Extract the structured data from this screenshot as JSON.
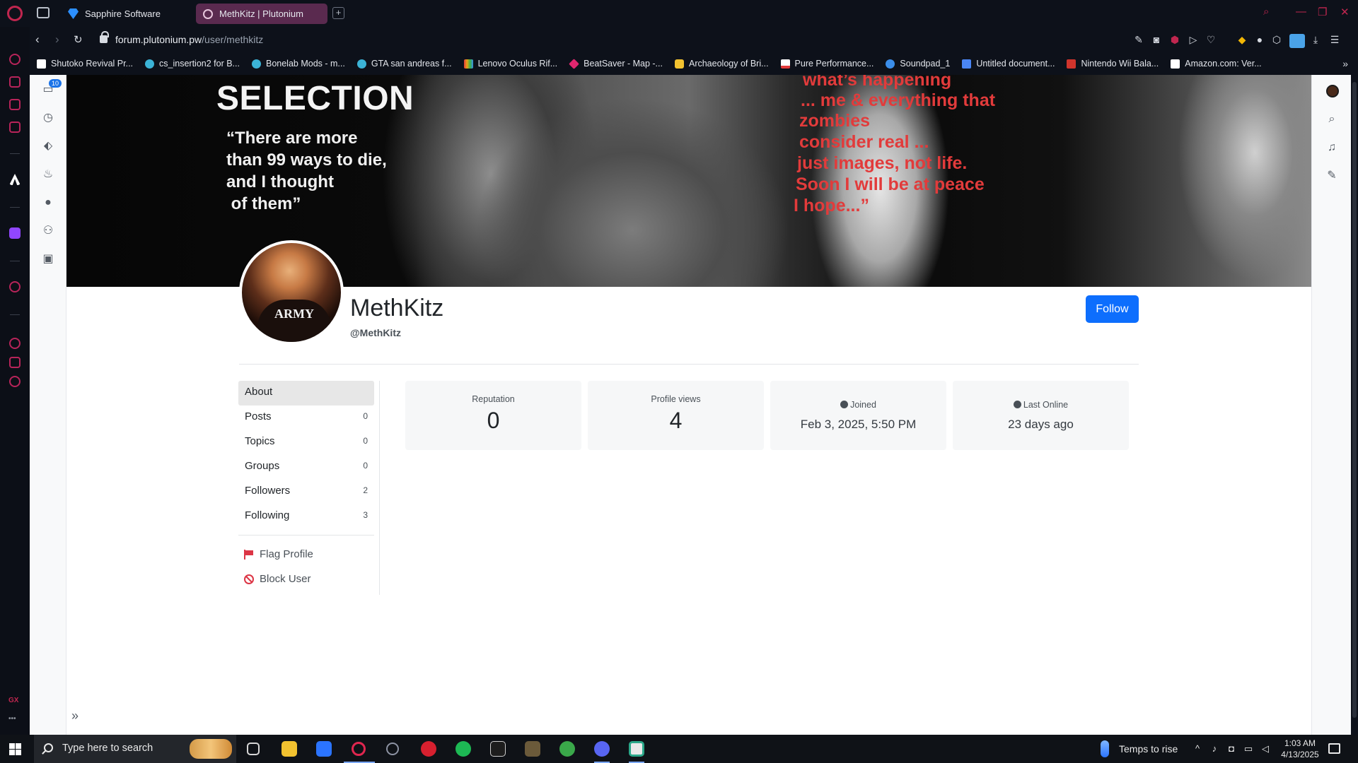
{
  "browser": {
    "tabs": [
      {
        "label": "Sapphire Software"
      },
      {
        "label": "MethKitz | Plutonium"
      }
    ],
    "new_tab": "+",
    "url_host": "forum.plutonium.pw",
    "url_path": "/user/methkitz",
    "bookmarks": [
      {
        "label": "Shutoko Revival Pr...",
        "color": "#ffffff"
      },
      {
        "label": "cs_insertion2 for B...",
        "color": "#3bb3d6"
      },
      {
        "label": "Bonelab Mods - m...",
        "color": "#3bb3d6"
      },
      {
        "label": "GTA san andreas f...",
        "color": "#3bb3d6"
      },
      {
        "label": "Lenovo Oculus Rif...",
        "color": "#e8a317"
      },
      {
        "label": "BeatSaver - Map -...",
        "color": "#e0266e"
      },
      {
        "label": "Archaeology of Bri...",
        "color": "#f2c230"
      },
      {
        "label": "Pure Performance...",
        "color": "#e33b3b"
      },
      {
        "label": "Soundpad_1",
        "color": "#3b8eea"
      },
      {
        "label": "Untitled document...",
        "color": "#4a86f5"
      },
      {
        "label": "Nintendo Wii Bala...",
        "color": "#d0342c"
      },
      {
        "label": "Amazon.com: Ver...",
        "color": "#ffffff"
      }
    ]
  },
  "forum_sidebar": {
    "inbox_badge": "10"
  },
  "cover": {
    "selection": "SELECTION",
    "quote_lines": [
      "“There are more",
      "than 99 ways to die,",
      "and I thought",
      " of them”"
    ],
    "red_lines": [
      "what’s happening",
      "... me & everything that",
      "zombies",
      "consider real ...",
      "just images, not life.",
      "Soon I will be at peace",
      "I hope...”"
    ]
  },
  "profile": {
    "avatar_text": "ARMY",
    "display_name": "MethKitz",
    "username": "@MethKitz",
    "follow_label": "Follow"
  },
  "nav": [
    {
      "label": "About",
      "count": ""
    },
    {
      "label": "Posts",
      "count": "0"
    },
    {
      "label": "Topics",
      "count": "0"
    },
    {
      "label": "Groups",
      "count": "0"
    },
    {
      "label": "Followers",
      "count": "2"
    },
    {
      "label": "Following",
      "count": "3"
    }
  ],
  "actions": {
    "flag": "Flag Profile",
    "block": "Block User"
  },
  "stats": {
    "reputation_label": "Reputation",
    "reputation_value": "0",
    "views_label": "Profile views",
    "views_value": "4",
    "joined_label": "Joined",
    "joined_value": "Feb 3, 2025, 5:50 PM",
    "online_label": "Last Online",
    "online_value": "23 days ago"
  },
  "taskbar": {
    "search_placeholder": "Type here to search",
    "weather_text": "Temps to rise",
    "time": "1:03 AM",
    "date": "4/13/2025"
  },
  "colors": {
    "accent": "#0d6efd",
    "danger": "#dc3545",
    "opera_red": "#c0264f"
  }
}
